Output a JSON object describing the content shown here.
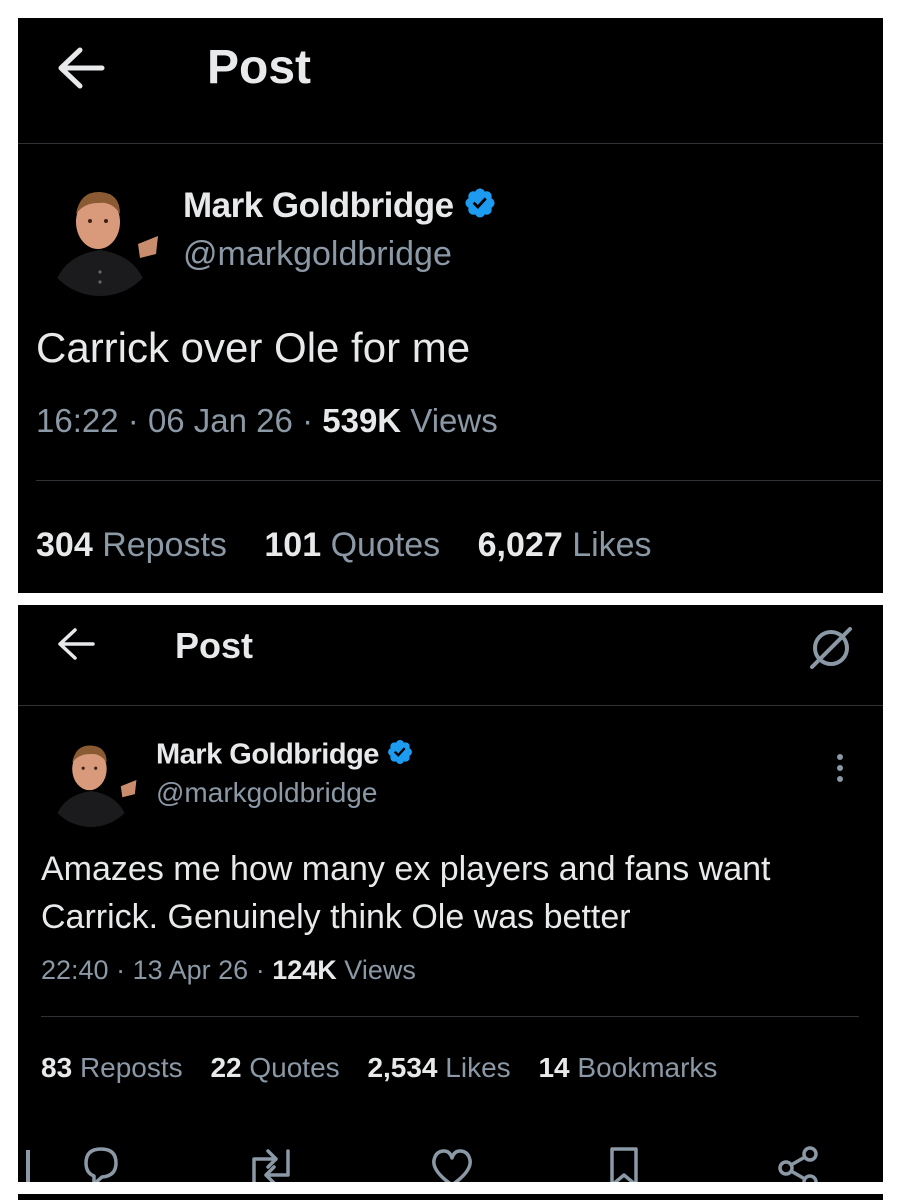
{
  "post1": {
    "header": {
      "title": "Post"
    },
    "author": {
      "name": "Mark Goldbridge",
      "handle": "@markgoldbridge"
    },
    "text": "Carrick over Ole for me",
    "meta": {
      "time": "16:22",
      "sep1": "·",
      "date": "06 Jan 26",
      "sep2": "·",
      "views_count": "539K",
      "views_label": "Views"
    },
    "stats": {
      "reposts_count": "304",
      "reposts_label": "Reposts",
      "quotes_count": "101",
      "quotes_label": "Quotes",
      "likes_count": "6,027",
      "likes_label": "Likes"
    }
  },
  "post2": {
    "header": {
      "title": "Post"
    },
    "author": {
      "name": "Mark Goldbridge",
      "handle": "@markgoldbridge"
    },
    "text_line1": "Amazes me how many ex players and fans want",
    "text_line2": "Carrick. Genuinely think Ole was better",
    "meta": {
      "time": "22:40",
      "sep1": "·",
      "date": "13 Apr 26",
      "sep2": "·",
      "views_count": "124K",
      "views_label": "Views"
    },
    "stats": {
      "reposts_count": "83",
      "reposts_label": "Reposts",
      "quotes_count": "22",
      "quotes_label": "Quotes",
      "likes_count": "2,534",
      "likes_label": "Likes",
      "bookmarks_count": "14",
      "bookmarks_label": "Bookmarks"
    }
  },
  "icons": {
    "back": "back-arrow-icon",
    "grok": "grok-icon",
    "verified": "verified-badge-icon",
    "more": "more-options-icon",
    "reply": "reply-icon",
    "repost": "repost-icon",
    "like": "like-icon",
    "bookmark": "bookmark-icon",
    "share": "share-icon"
  },
  "colors": {
    "background": "#000000",
    "text": "#e7e9ea",
    "secondary": "#8b98a5",
    "verified": "#1d9bf0",
    "divider": "#2f3336"
  }
}
